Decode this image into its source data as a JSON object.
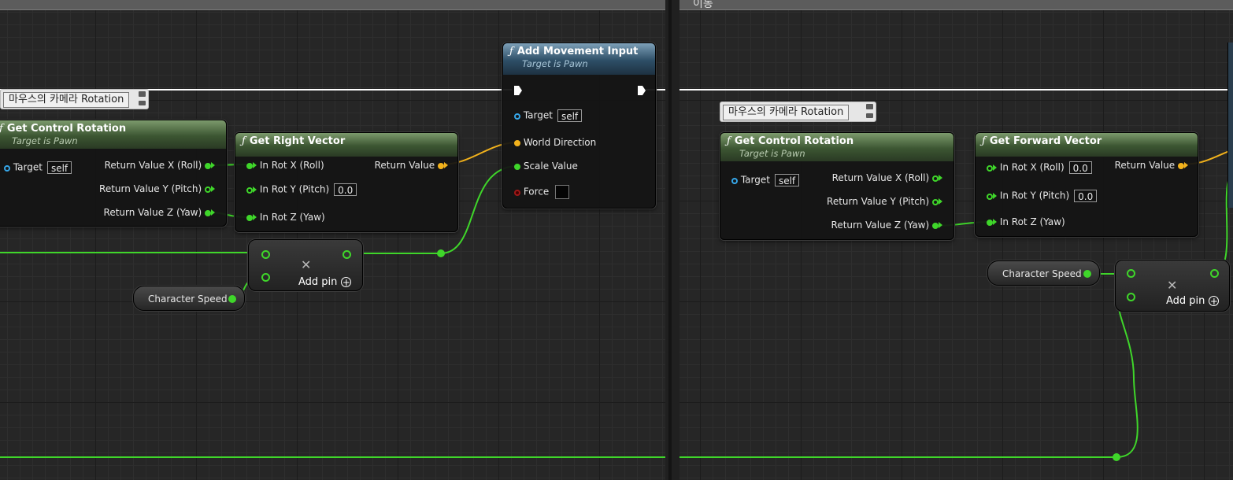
{
  "comment": {
    "title": "이동"
  },
  "bubbles": {
    "left": "마우스의 카메라 Rotation",
    "right": "마우스의 카메라 Rotation"
  },
  "nodes": {
    "getControlRotationLeft": {
      "icon": "function-icon",
      "title": "Get Control Rotation",
      "subtitle": "Target is Pawn",
      "target_label": "Target",
      "target_value": "self",
      "outputs": [
        "Return Value X (Roll)",
        "Return Value Y (Pitch)",
        "Return Value Z (Yaw)"
      ]
    },
    "getRightVector": {
      "icon": "function-icon",
      "title": "Get Right Vector",
      "inputs": [
        "In Rot X (Roll)",
        "In Rot Y (Pitch)",
        "In Rot Z (Yaw)"
      ],
      "pitch_value": "0.0",
      "output": "Return Value"
    },
    "addMovementInput": {
      "icon": "function-icon",
      "title": "Add Movement Input",
      "subtitle": "Target is Pawn",
      "target_label": "Target",
      "target_value": "self",
      "world_direction": "World Direction",
      "scale_value": "Scale Value",
      "force": "Force"
    },
    "multiplyLeft": {
      "add_pin": "Add pin"
    },
    "characterSpeedLeft": {
      "label": "Character Speed"
    },
    "getControlRotationRight": {
      "icon": "function-icon",
      "title": "Get Control Rotation",
      "subtitle": "Target is Pawn",
      "target_label": "Target",
      "target_value": "self",
      "outputs": [
        "Return Value X (Roll)",
        "Return Value Y (Pitch)",
        "Return Value Z (Yaw)"
      ]
    },
    "getForwardVector": {
      "icon": "function-icon",
      "title": "Get Forward Vector",
      "inputs": [
        "In Rot X (Roll)",
        "In Rot Y (Pitch)",
        "In Rot Z (Yaw)"
      ],
      "roll_value": "0.0",
      "pitch_value": "0.0",
      "output": "Return Value"
    },
    "characterSpeedRight": {
      "label": "Character Speed"
    },
    "multiplyRight": {
      "add_pin": "Add pin"
    }
  },
  "colors": {
    "exec_wire": "#ffffff",
    "float_wire": "#3fd62a",
    "vector_wire": "#f2b21c",
    "object_pin": "#36a6e8",
    "function_header": "#3c5632",
    "call_header": "#2d4e66"
  }
}
